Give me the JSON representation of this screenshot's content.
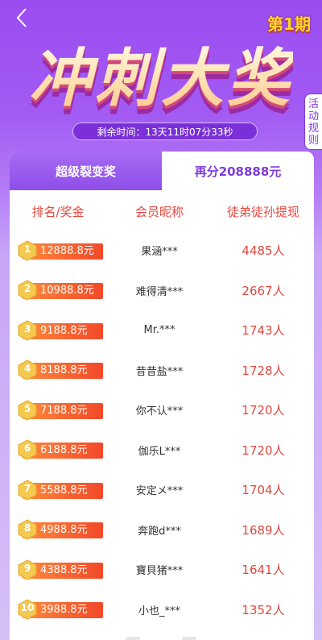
{
  "nav": {
    "back_icon": "chevron-left-icon"
  },
  "header": {
    "period_label": "第1期",
    "banner_title": "冲刺大奖",
    "countdown": "剩余时间：13天11时07分33秒",
    "rules_tab": [
      "活",
      "动",
      "规",
      "则"
    ]
  },
  "tabs": [
    {
      "label": "超级裂变奖",
      "active": false
    },
    {
      "label": "再分208888元",
      "active": true
    }
  ],
  "table": {
    "headers": [
      "排名/奖金",
      "会员昵称",
      "徒弟徒孙提现"
    ],
    "rows": [
      {
        "rank": "1",
        "prize": "12888.8元",
        "name": "果涵***",
        "count": "4485人"
      },
      {
        "rank": "2",
        "prize": "10988.8元",
        "name": "难得清***",
        "count": "2667人"
      },
      {
        "rank": "3",
        "prize": "9188.8元",
        "name": "Mr.***",
        "count": "1743人"
      },
      {
        "rank": "4",
        "prize": "8188.8元",
        "name": "昔昔盐***",
        "count": "1728人"
      },
      {
        "rank": "5",
        "prize": "7188.8元",
        "name": "你不认***",
        "count": "1720人"
      },
      {
        "rank": "6",
        "prize": "6188.8元",
        "name": "伽乐L***",
        "count": "1720人"
      },
      {
        "rank": "7",
        "prize": "5588.8元",
        "name": "安定メ***",
        "count": "1704人"
      },
      {
        "rank": "8",
        "prize": "4988.8元",
        "name": "奔跑d***",
        "count": "1689人"
      },
      {
        "rank": "9",
        "prize": "4388.8元",
        "name": "寶貝猪***",
        "count": "1641人"
      },
      {
        "rank": "10",
        "prize": "3988.8元",
        "name": "小也_***",
        "count": "1352人"
      }
    ]
  },
  "colors": {
    "accent_purple": "#7e3bd9",
    "highlight_red": "#e2473f",
    "prize_orange": "#ff8a3c",
    "badge_gold": "#f3c94f"
  }
}
